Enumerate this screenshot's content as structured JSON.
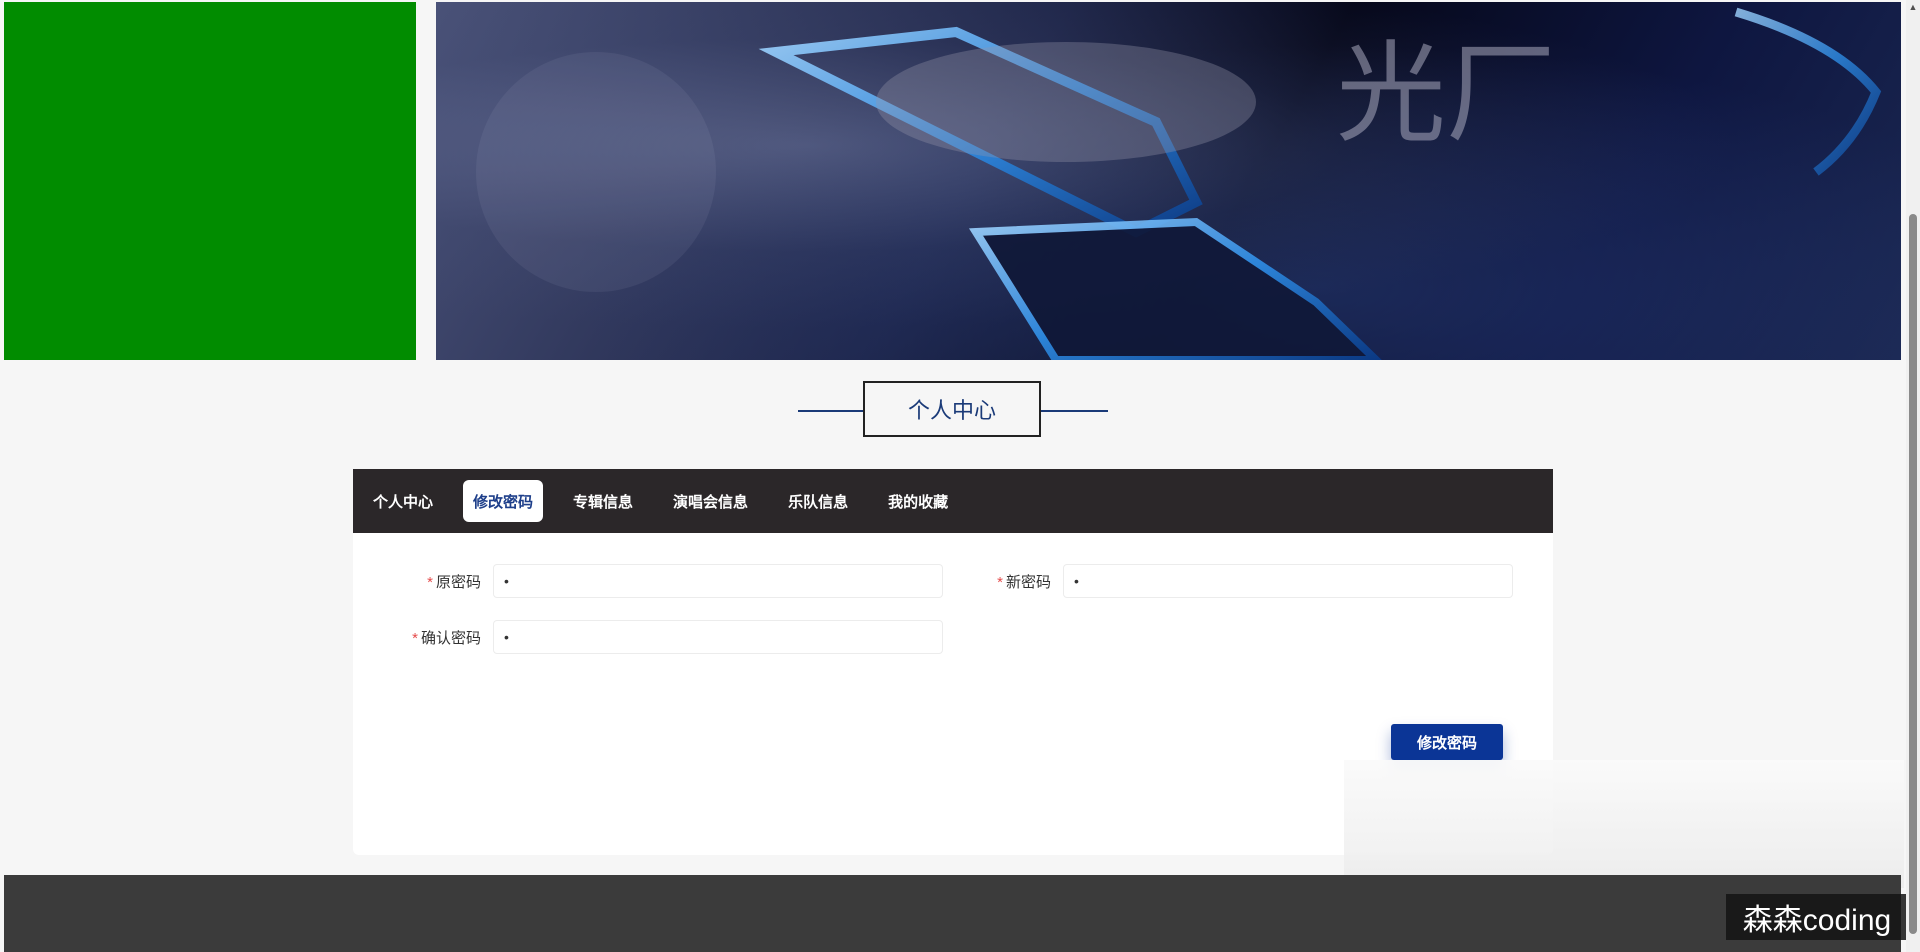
{
  "banner": {
    "text": "光厂"
  },
  "section": {
    "title": "个人中心"
  },
  "tabs": [
    {
      "label": "个人中心",
      "active": false
    },
    {
      "label": "修改密码",
      "active": true
    },
    {
      "label": "专辑信息",
      "active": false
    },
    {
      "label": "演唱会信息",
      "active": false
    },
    {
      "label": "乐队信息",
      "active": false
    },
    {
      "label": "我的收藏",
      "active": false
    }
  ],
  "form": {
    "old_password": {
      "label": "原密码",
      "value": "•"
    },
    "new_password": {
      "label": "新密码",
      "value": "•"
    },
    "confirm_password": {
      "label": "确认密码",
      "value": "•"
    },
    "required_mark": "*",
    "submit_label": "修改密码"
  },
  "watermark": "森森coding",
  "colors": {
    "logo_green": "#018c00",
    "nav_bg": "#2b2729",
    "accent_blue": "#0b3596",
    "title_blue": "#1a3a78",
    "footer_bg": "#3b3b3b"
  }
}
